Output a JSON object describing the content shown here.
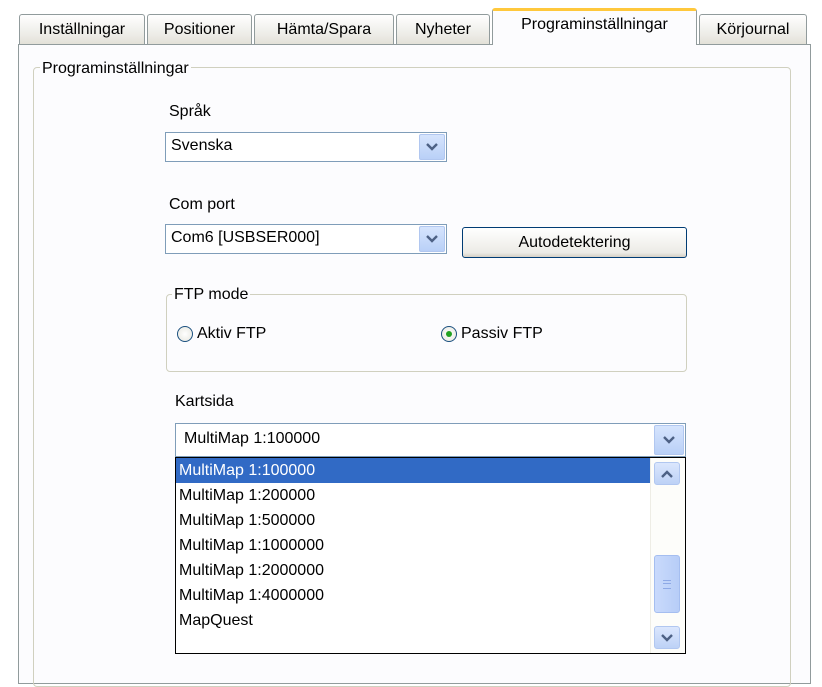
{
  "tabs": [
    {
      "label": "Inställningar"
    },
    {
      "label": "Positioner"
    },
    {
      "label": "Hämta/Spara"
    },
    {
      "label": "Nyheter"
    },
    {
      "label": "Programinställningar",
      "active": true
    },
    {
      "label": "Körjournal"
    }
  ],
  "group": {
    "title": "Programinställningar"
  },
  "language": {
    "label": "Språk",
    "value": "Svenska"
  },
  "com_port": {
    "label": "Com port",
    "value": "Com6 [USBSER000]",
    "button": "Autodetektering"
  },
  "ftp_mode": {
    "title": "FTP mode",
    "options": [
      {
        "label": "Aktiv FTP",
        "selected": false
      },
      {
        "label": "Passiv FTP",
        "selected": true
      }
    ]
  },
  "map_page": {
    "label": "Kartsida",
    "value": "MultiMap 1:100000",
    "options": [
      "MultiMap 1:100000",
      "MultiMap 1:200000",
      "MultiMap 1:500000",
      "MultiMap 1:1000000",
      "MultiMap 1:2000000",
      "MultiMap 1:4000000",
      "MapQuest"
    ],
    "selected_index": 0
  },
  "icons": {
    "combo_arrow": "chevron-down-icon",
    "scroll_up": "chevron-up-icon",
    "scroll_down": "chevron-down-icon",
    "scroll_thumb": "grip-icon"
  },
  "colors": {
    "selection": "#316ac5",
    "active_tab_accent": "#ffc83c",
    "radio_dot": "#21a121"
  }
}
